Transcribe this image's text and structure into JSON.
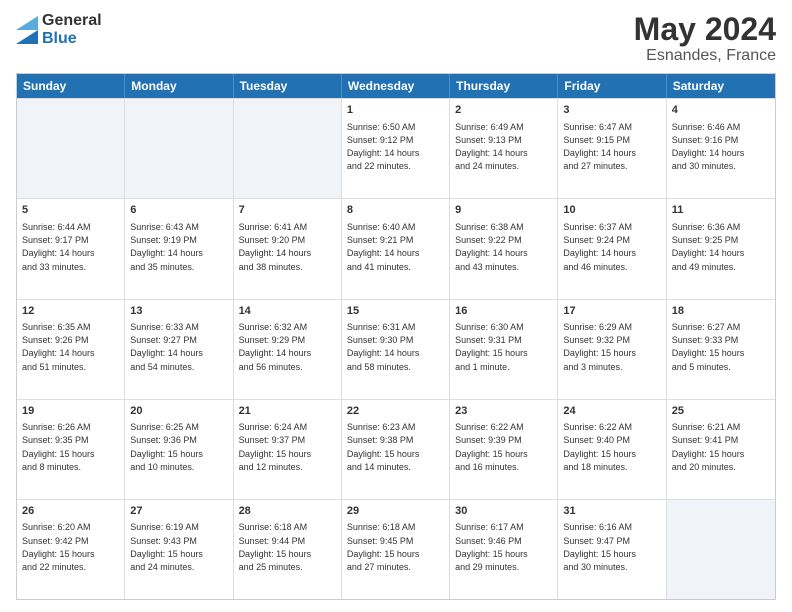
{
  "logo": {
    "general": "General",
    "blue": "Blue"
  },
  "title": "May 2024",
  "location": "Esnandes, France",
  "weekdays": [
    "Sunday",
    "Monday",
    "Tuesday",
    "Wednesday",
    "Thursday",
    "Friday",
    "Saturday"
  ],
  "rows": [
    [
      {
        "day": "",
        "text": ""
      },
      {
        "day": "",
        "text": ""
      },
      {
        "day": "",
        "text": ""
      },
      {
        "day": "1",
        "text": "Sunrise: 6:50 AM\nSunset: 9:12 PM\nDaylight: 14 hours\nand 22 minutes."
      },
      {
        "day": "2",
        "text": "Sunrise: 6:49 AM\nSunset: 9:13 PM\nDaylight: 14 hours\nand 24 minutes."
      },
      {
        "day": "3",
        "text": "Sunrise: 6:47 AM\nSunset: 9:15 PM\nDaylight: 14 hours\nand 27 minutes."
      },
      {
        "day": "4",
        "text": "Sunrise: 6:46 AM\nSunset: 9:16 PM\nDaylight: 14 hours\nand 30 minutes."
      }
    ],
    [
      {
        "day": "5",
        "text": "Sunrise: 6:44 AM\nSunset: 9:17 PM\nDaylight: 14 hours\nand 33 minutes."
      },
      {
        "day": "6",
        "text": "Sunrise: 6:43 AM\nSunset: 9:19 PM\nDaylight: 14 hours\nand 35 minutes."
      },
      {
        "day": "7",
        "text": "Sunrise: 6:41 AM\nSunset: 9:20 PM\nDaylight: 14 hours\nand 38 minutes."
      },
      {
        "day": "8",
        "text": "Sunrise: 6:40 AM\nSunset: 9:21 PM\nDaylight: 14 hours\nand 41 minutes."
      },
      {
        "day": "9",
        "text": "Sunrise: 6:38 AM\nSunset: 9:22 PM\nDaylight: 14 hours\nand 43 minutes."
      },
      {
        "day": "10",
        "text": "Sunrise: 6:37 AM\nSunset: 9:24 PM\nDaylight: 14 hours\nand 46 minutes."
      },
      {
        "day": "11",
        "text": "Sunrise: 6:36 AM\nSunset: 9:25 PM\nDaylight: 14 hours\nand 49 minutes."
      }
    ],
    [
      {
        "day": "12",
        "text": "Sunrise: 6:35 AM\nSunset: 9:26 PM\nDaylight: 14 hours\nand 51 minutes."
      },
      {
        "day": "13",
        "text": "Sunrise: 6:33 AM\nSunset: 9:27 PM\nDaylight: 14 hours\nand 54 minutes."
      },
      {
        "day": "14",
        "text": "Sunrise: 6:32 AM\nSunset: 9:29 PM\nDaylight: 14 hours\nand 56 minutes."
      },
      {
        "day": "15",
        "text": "Sunrise: 6:31 AM\nSunset: 9:30 PM\nDaylight: 14 hours\nand 58 minutes."
      },
      {
        "day": "16",
        "text": "Sunrise: 6:30 AM\nSunset: 9:31 PM\nDaylight: 15 hours\nand 1 minute."
      },
      {
        "day": "17",
        "text": "Sunrise: 6:29 AM\nSunset: 9:32 PM\nDaylight: 15 hours\nand 3 minutes."
      },
      {
        "day": "18",
        "text": "Sunrise: 6:27 AM\nSunset: 9:33 PM\nDaylight: 15 hours\nand 5 minutes."
      }
    ],
    [
      {
        "day": "19",
        "text": "Sunrise: 6:26 AM\nSunset: 9:35 PM\nDaylight: 15 hours\nand 8 minutes."
      },
      {
        "day": "20",
        "text": "Sunrise: 6:25 AM\nSunset: 9:36 PM\nDaylight: 15 hours\nand 10 minutes."
      },
      {
        "day": "21",
        "text": "Sunrise: 6:24 AM\nSunset: 9:37 PM\nDaylight: 15 hours\nand 12 minutes."
      },
      {
        "day": "22",
        "text": "Sunrise: 6:23 AM\nSunset: 9:38 PM\nDaylight: 15 hours\nand 14 minutes."
      },
      {
        "day": "23",
        "text": "Sunrise: 6:22 AM\nSunset: 9:39 PM\nDaylight: 15 hours\nand 16 minutes."
      },
      {
        "day": "24",
        "text": "Sunrise: 6:22 AM\nSunset: 9:40 PM\nDaylight: 15 hours\nand 18 minutes."
      },
      {
        "day": "25",
        "text": "Sunrise: 6:21 AM\nSunset: 9:41 PM\nDaylight: 15 hours\nand 20 minutes."
      }
    ],
    [
      {
        "day": "26",
        "text": "Sunrise: 6:20 AM\nSunset: 9:42 PM\nDaylight: 15 hours\nand 22 minutes."
      },
      {
        "day": "27",
        "text": "Sunrise: 6:19 AM\nSunset: 9:43 PM\nDaylight: 15 hours\nand 24 minutes."
      },
      {
        "day": "28",
        "text": "Sunrise: 6:18 AM\nSunset: 9:44 PM\nDaylight: 15 hours\nand 25 minutes."
      },
      {
        "day": "29",
        "text": "Sunrise: 6:18 AM\nSunset: 9:45 PM\nDaylight: 15 hours\nand 27 minutes."
      },
      {
        "day": "30",
        "text": "Sunrise: 6:17 AM\nSunset: 9:46 PM\nDaylight: 15 hours\nand 29 minutes."
      },
      {
        "day": "31",
        "text": "Sunrise: 6:16 AM\nSunset: 9:47 PM\nDaylight: 15 hours\nand 30 minutes."
      },
      {
        "day": "",
        "text": ""
      }
    ]
  ]
}
